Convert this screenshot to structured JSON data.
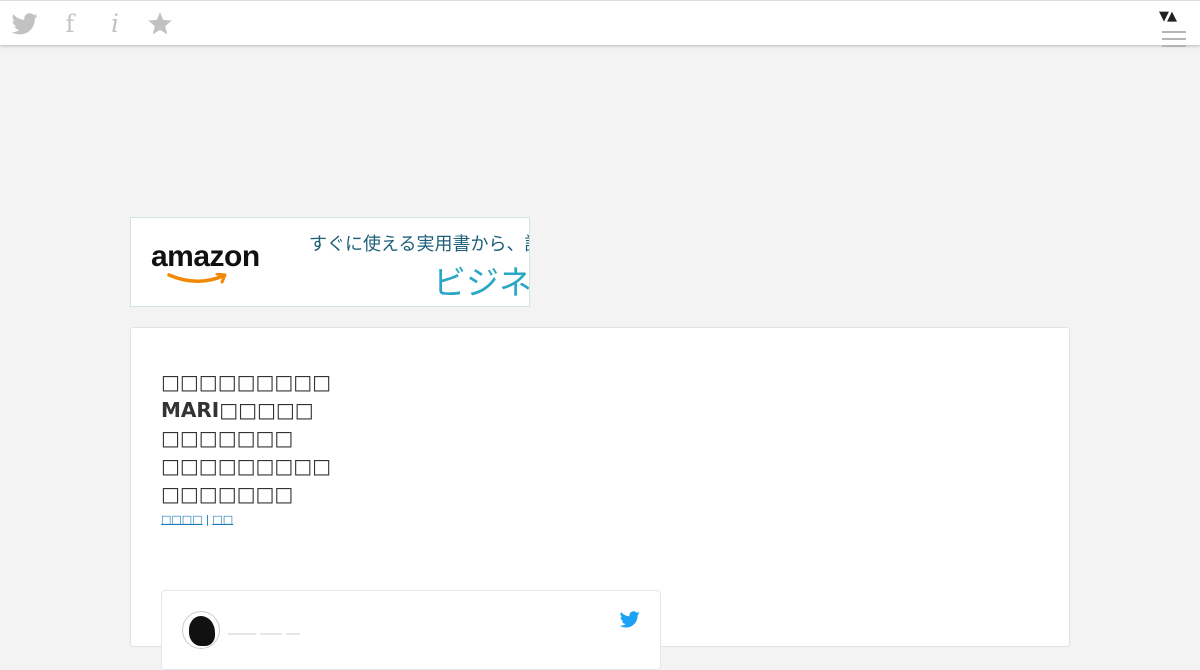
{
  "toolbar": {
    "icons": [
      "twitter-icon",
      "facebook-icon",
      "info-icon",
      "star-icon",
      "sort-toggle-icon",
      "menu-icon"
    ],
    "facebook_glyph": "f",
    "info_glyph": "i",
    "sort_glyph": "▼▲",
    "icon_color": "#c2c2c2"
  },
  "ad_banner": {
    "brand": "amazon",
    "line1": "すぐに使える実用書から、読",
    "line2": "ビジネス",
    "brand_color": "#111111",
    "smile_color": "#f08804",
    "line1_color": "#1d5f78",
    "line2_color": "#2aa7c4"
  },
  "profile": {
    "lines": [
      "□□□□□□□□□",
      "MARI□□□□□",
      "□□□□□□□",
      "□□□□□□□□□",
      "□□□□□□□"
    ],
    "links": [
      "□□□□",
      "□□"
    ]
  },
  "tweet_embed": {
    "author": "____ ___ __",
    "bird_color": "#1da1f2"
  },
  "colors": {
    "page_bg": "#f3f3f3",
    "link": "#1b7ab8"
  }
}
